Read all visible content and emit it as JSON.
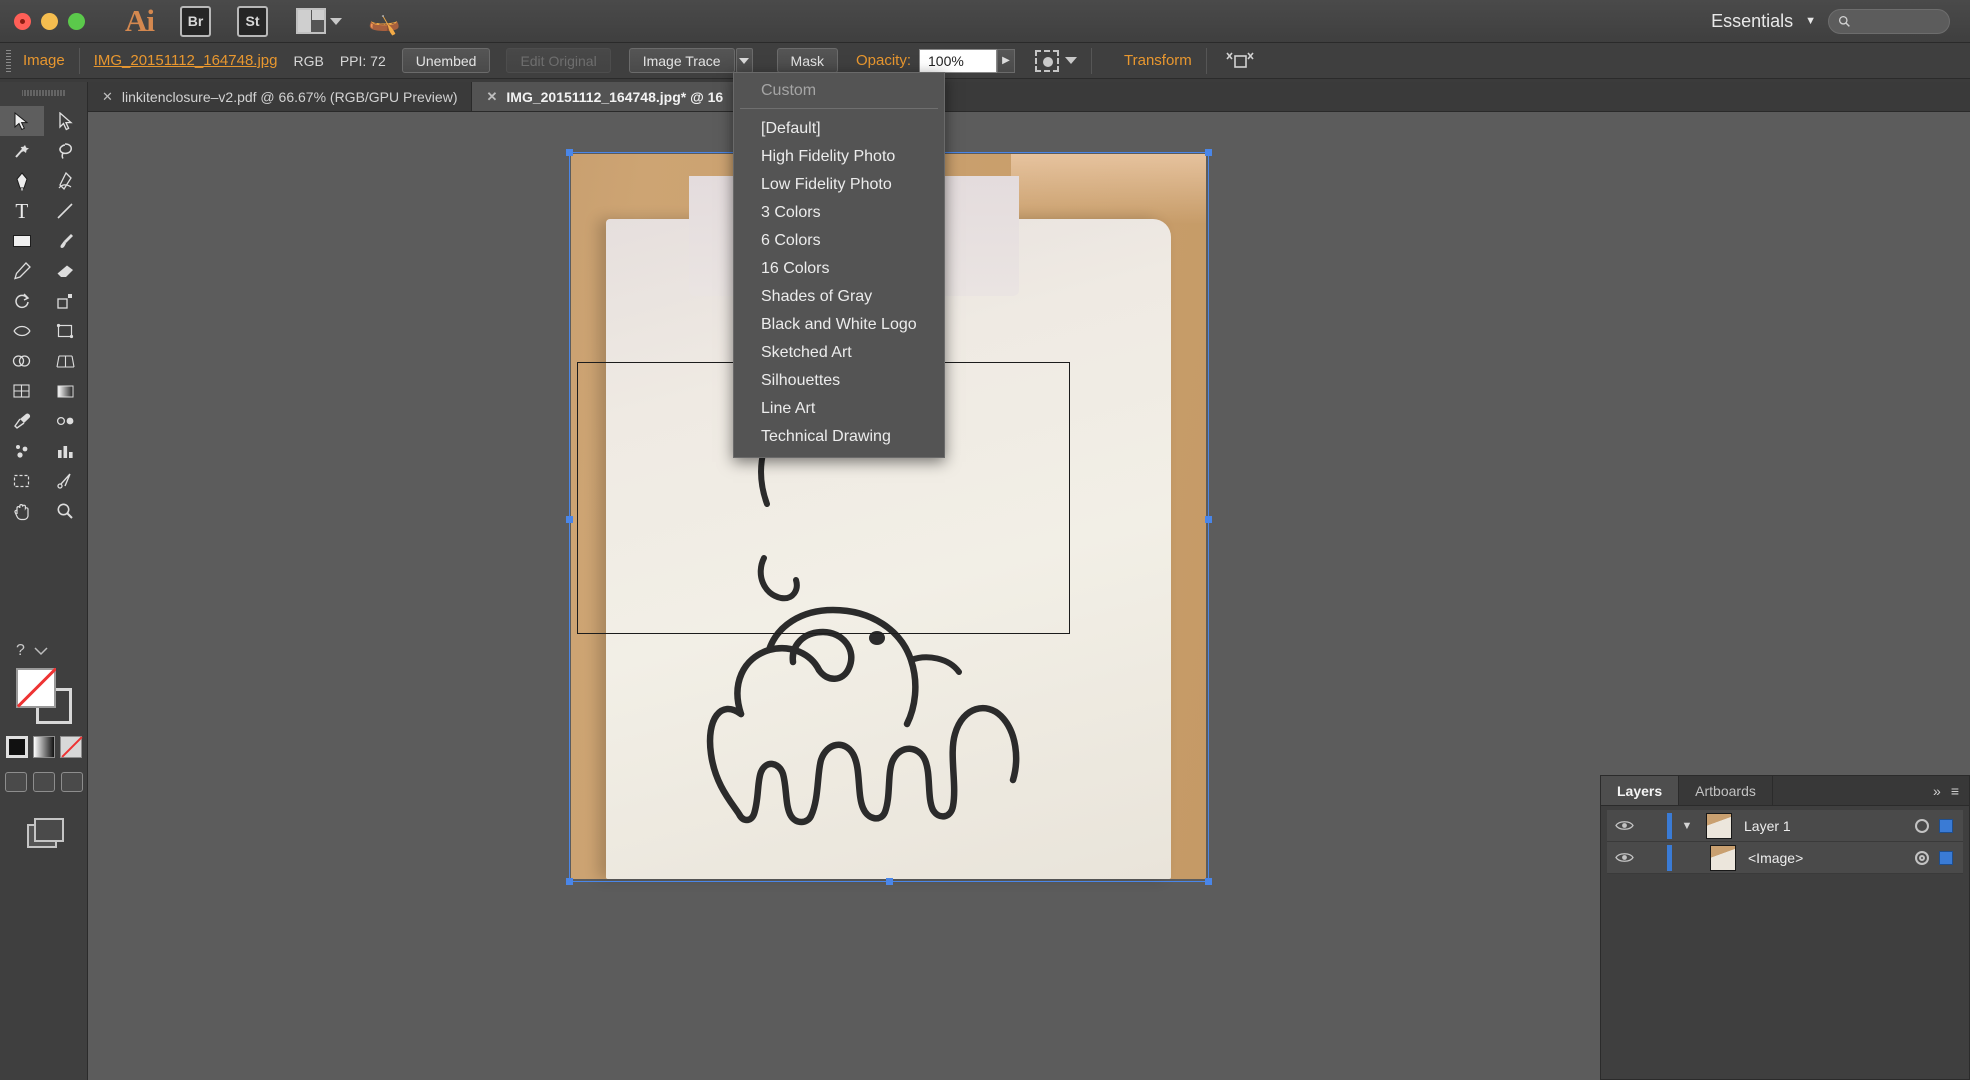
{
  "menubar": {
    "app_initials": "Ai",
    "bridge_label": "Br",
    "stock_label": "St",
    "arrange_icon": "arrange-documents-icon",
    "rocket_icon": "rocket-icon",
    "workspace_label": "Essentials",
    "workspace_caret": "▼",
    "search_icon": "search-icon",
    "search_placeholder": ""
  },
  "controlbar": {
    "object_type": "Image",
    "file_name": "IMG_20151112_164748.jpg",
    "color_mode": "RGB",
    "ppi": "PPI: 72",
    "unembed_label": "Unembed",
    "edit_original_label": "Edit Original",
    "image_trace_label": "Image Trace",
    "trace_caret_icon": "chevron-down-icon",
    "mask_label": "Mask",
    "opacity_label": "Opacity:",
    "opacity_value": "100%",
    "align_icon": "align-to-selection-icon",
    "transform_label": "Transform",
    "isolate_icon": "isolate-selected-object-icon"
  },
  "tabs": [
    {
      "label": "linkitenclosure–v2.pdf @ 66.67% (RGB/GPU Preview)",
      "close_icon": "close-icon",
      "active": false
    },
    {
      "label": "IMG_20151112_164748.jpg* @ 16",
      "close_icon": "close-icon",
      "active": true
    }
  ],
  "toolbar": {
    "tools": [
      {
        "name": "selection-tool",
        "glyph": "➤"
      },
      {
        "name": "direct-selection-tool",
        "glyph": "➤"
      },
      {
        "name": "magic-wand-tool",
        "glyph": "✦"
      },
      {
        "name": "lasso-tool",
        "glyph": "℘"
      },
      {
        "name": "pen-tool",
        "glyph": "✒"
      },
      {
        "name": "curvature-tool",
        "glyph": "✒"
      },
      {
        "name": "type-tool",
        "glyph": "T"
      },
      {
        "name": "line-segment-tool",
        "glyph": "╱"
      },
      {
        "name": "rectangle-tool",
        "glyph": "▭"
      },
      {
        "name": "paintbrush-tool",
        "glyph": "✐"
      },
      {
        "name": "pencil-tool",
        "glyph": "✎"
      },
      {
        "name": "eraser-tool",
        "glyph": "▱"
      },
      {
        "name": "rotate-tool",
        "glyph": "↺"
      },
      {
        "name": "scale-tool",
        "glyph": "⤡"
      },
      {
        "name": "width-tool",
        "glyph": "≈"
      },
      {
        "name": "free-transform-tool",
        "glyph": "⬚"
      },
      {
        "name": "shape-builder-tool",
        "glyph": "◔"
      },
      {
        "name": "perspective-grid-tool",
        "glyph": "◢"
      },
      {
        "name": "mesh-tool",
        "glyph": "⊞"
      },
      {
        "name": "gradient-tool",
        "glyph": "▧"
      },
      {
        "name": "eyedropper-tool",
        "glyph": "☂"
      },
      {
        "name": "blend-tool",
        "glyph": "❁"
      },
      {
        "name": "symbol-sprayer-tool",
        "glyph": "❁"
      },
      {
        "name": "column-graph-tool",
        "glyph": "█"
      },
      {
        "name": "artboard-tool",
        "glyph": "⬚"
      },
      {
        "name": "slice-tool",
        "glyph": "✂"
      },
      {
        "name": "hand-tool",
        "glyph": "✋"
      },
      {
        "name": "zoom-tool",
        "glyph": "⌕"
      }
    ],
    "help_glyph": "?",
    "fill_label": "fill-swatch",
    "stroke_label": "stroke-swatch",
    "none_label": "none-swatch",
    "color_mini": "color-swatch",
    "gradient_mini": "gradient-swatch",
    "none_mini": "none-swatch",
    "draw_normal": "draw-normal-mode",
    "draw_behind": "draw-behind-mode",
    "draw_inside": "draw-inside-mode",
    "screen_mode": "change-screen-mode"
  },
  "trace_menu": {
    "header": "Custom",
    "items": [
      "[Default]",
      "High Fidelity Photo",
      "Low Fidelity Photo",
      "3 Colors",
      "6 Colors",
      "16 Colors",
      "Shades of Gray",
      "Black and White Logo",
      "Sketched Art",
      "Silhouettes",
      "Line Art",
      "Technical Drawing"
    ]
  },
  "layers_panel": {
    "tabs": [
      {
        "label": "Layers",
        "active": true
      },
      {
        "label": "Artboards",
        "active": false
      }
    ],
    "collapse_icon": "double-chevron-right-icon",
    "menu_icon": "panel-menu-icon",
    "rows": [
      {
        "name": "Layer 1",
        "eye_icon": "eye-icon",
        "disclosure_icon": "triangle-down-icon",
        "thumb": "layer-thumbnail",
        "target_icon": "target-circle-icon",
        "select_icon": "selection-square-icon",
        "indented": false
      },
      {
        "name": "<Image>",
        "eye_icon": "eye-icon",
        "disclosure_icon": "",
        "thumb": "image-thumbnail",
        "target_icon": "target-circle-double-icon",
        "select_icon": "selection-square-icon",
        "indented": true
      }
    ]
  },
  "colors": {
    "accent_orange": "#e8972f",
    "selection_blue": "#4a86e8",
    "panel_bg": "#3f3f3f",
    "canvas_bg": "#5c5c5c",
    "menu_bg": "#545454",
    "layer_blue": "#3a7bd5"
  }
}
